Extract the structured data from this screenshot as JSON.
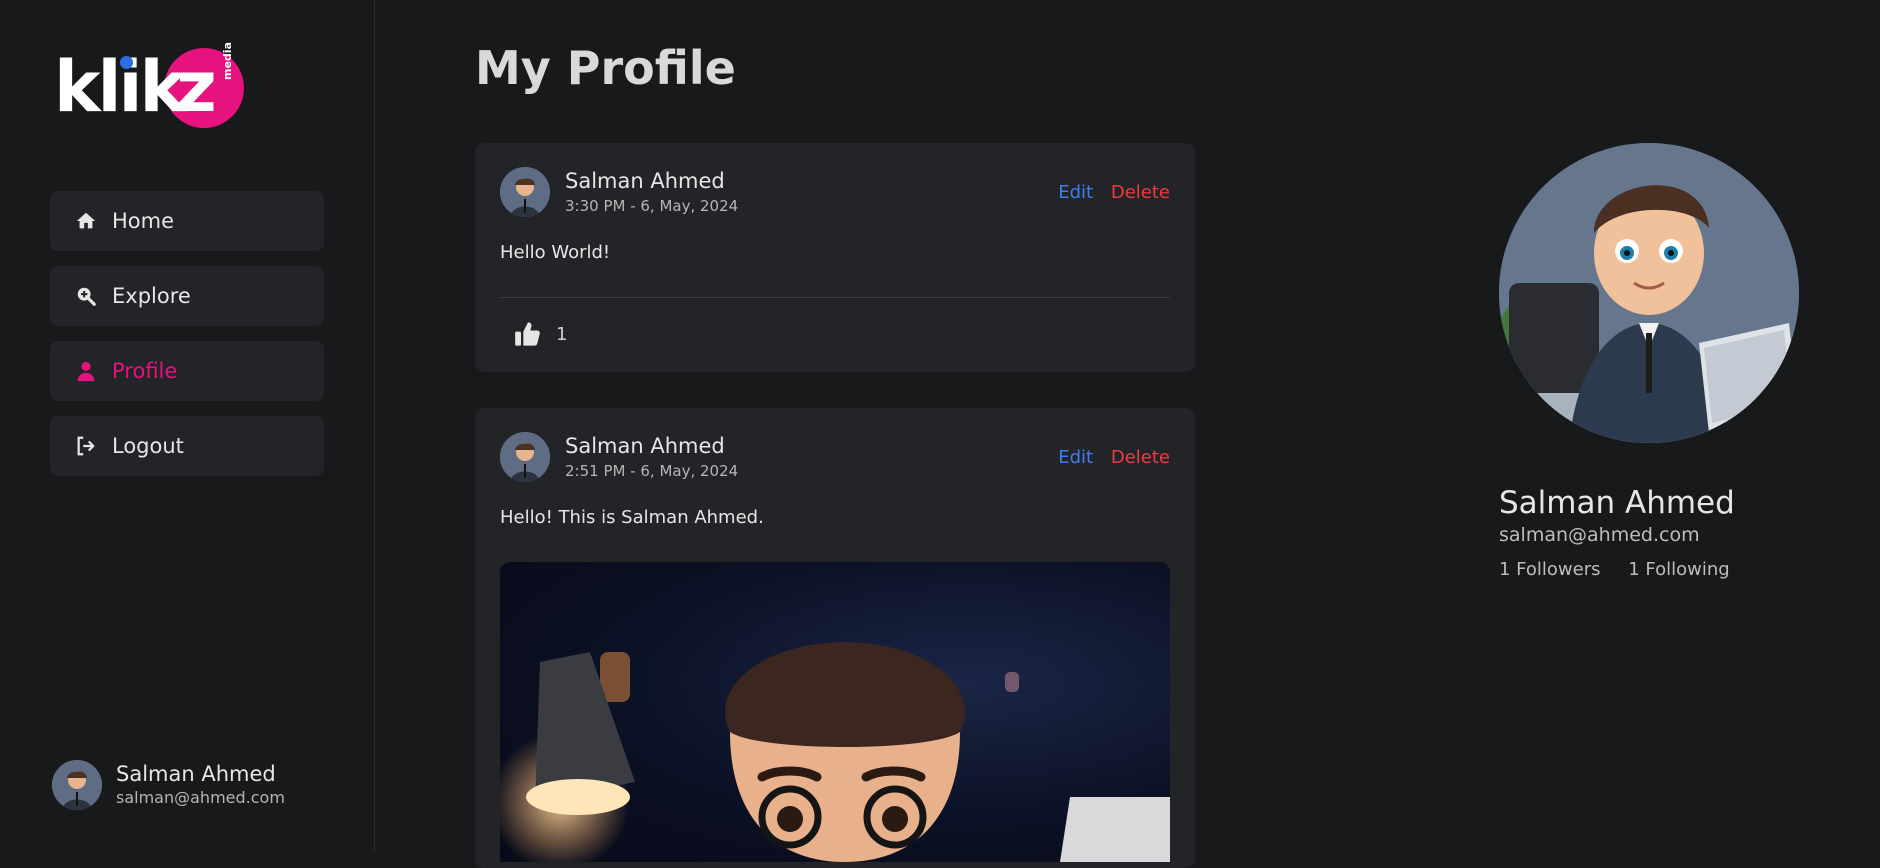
{
  "brand": {
    "logo_text": "klik",
    "logo_z": "z",
    "logo_sub": "media"
  },
  "nav": {
    "items": [
      {
        "label": "Home",
        "icon": "home-icon"
      },
      {
        "label": "Explore",
        "icon": "search-plus-icon"
      },
      {
        "label": "Profile",
        "icon": "user-icon",
        "active": true
      },
      {
        "label": "Logout",
        "icon": "logout-icon"
      }
    ]
  },
  "current_user": {
    "name": "Salman Ahmed",
    "email": "salman@ahmed.com"
  },
  "page": {
    "title": "My Profile"
  },
  "posts": [
    {
      "author": "Salman Ahmed",
      "time": "3:30 PM - 6, May, 2024",
      "edit_label": "Edit",
      "delete_label": "Delete",
      "text": "Hello World!",
      "likes": "1"
    },
    {
      "author": "Salman Ahmed",
      "time": "2:51 PM - 6, May, 2024",
      "edit_label": "Edit",
      "delete_label": "Delete",
      "text": "Hello! This is Salman Ahmed."
    }
  ],
  "profile": {
    "name": "Salman Ahmed",
    "email": "salman@ahmed.com",
    "followers": "1 Followers",
    "following": "1 Following"
  },
  "colors": {
    "accent": "#e6137e",
    "edit": "#3d7ff0",
    "delete": "#ee3b43",
    "background": "#18191b",
    "card": "#232427"
  }
}
